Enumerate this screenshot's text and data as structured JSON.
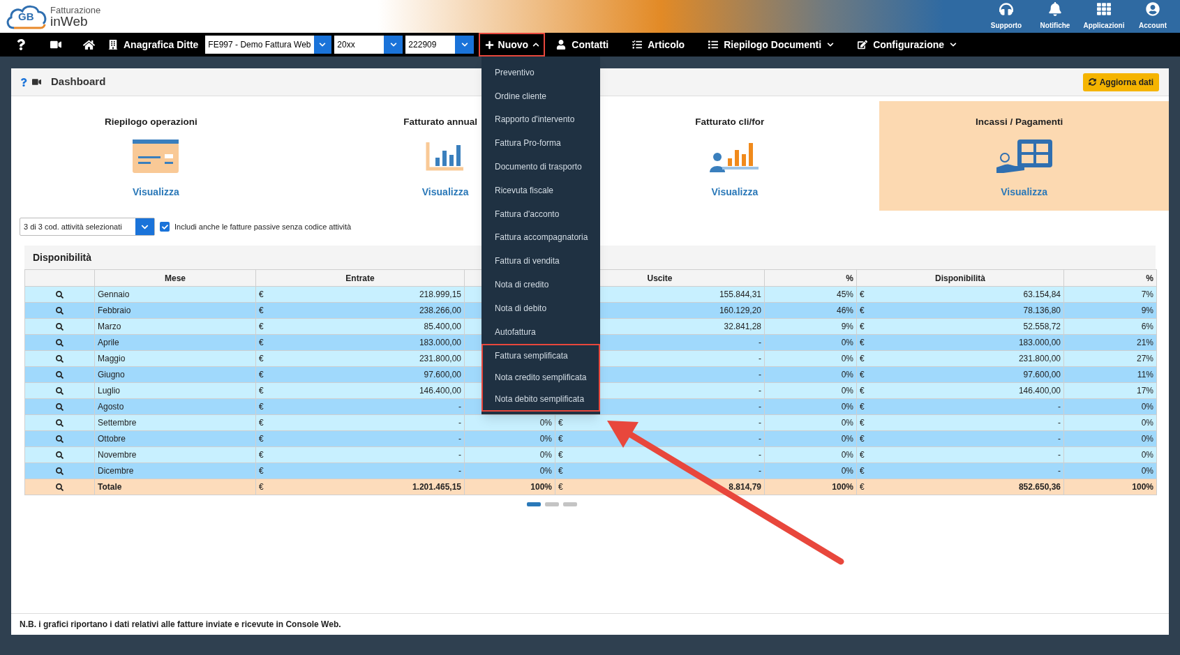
{
  "header": {
    "logo": {
      "mark": "GB",
      "line1": "Fatturazione",
      "line2": "inWeb"
    },
    "actions": [
      {
        "label": "Supporto"
      },
      {
        "label": "Notifiche"
      },
      {
        "label": "Applicazioni"
      },
      {
        "label": "Account"
      }
    ]
  },
  "nav": {
    "company_label": "Anagrafica Ditte",
    "selects": [
      {
        "value": "FE997 - Demo Fattura Web"
      },
      {
        "value": "20xx"
      },
      {
        "value": "222909"
      }
    ],
    "new_button": {
      "label": "Nuovo",
      "expanded": true,
      "outlined": true
    },
    "links": [
      {
        "label": "Contatti",
        "has_caret": false
      },
      {
        "label": "Articolo",
        "has_caret": false
      },
      {
        "label": "Riepilogo Documenti",
        "has_caret": true
      },
      {
        "label": "Configurazione",
        "has_caret": true
      }
    ]
  },
  "new_menu": {
    "items": [
      "Preventivo",
      "Ordine cliente",
      "Rapporto d'intervento",
      "Fattura Pro-forma",
      "Documento di trasporto",
      "Ricevuta fiscale",
      "Fattura d'acconto",
      "Fattura accompagnatoria",
      "Fattura di vendita",
      "Nota di credito",
      "Nota di debito",
      "Autofattura"
    ],
    "outlined_items": [
      "Fattura semplificata",
      "Nota credito semplificata",
      "Nota debito semplificata"
    ]
  },
  "dashboard": {
    "title": "Dashboard",
    "refresh_button": "Aggiorna dati",
    "tiles": [
      {
        "title": "Riepilogo operazioni",
        "link": "Visualizza",
        "selected": false
      },
      {
        "title": "Fatturato annual",
        "link": "Visualizza",
        "selected": false
      },
      {
        "title": "Fatturato cli/for",
        "link": "Visualizza",
        "selected": false
      },
      {
        "title": "Incassi / Pagamenti",
        "link": "Visualizza",
        "selected": true
      }
    ],
    "filter": {
      "value": "3 di 3 cod. attività selezionati",
      "checkbox": {
        "label": "Includi anche le fatture passive senza codice attività",
        "checked": true
      }
    },
    "availability": {
      "title": "Disponibilità",
      "columns": [
        {
          "label": "Mese"
        },
        {
          "label": "Entrate"
        },
        {},
        {
          "label": "Uscite"
        },
        {
          "label": "%"
        },
        {
          "label": "Disponibilità"
        },
        {
          "label": "%"
        }
      ],
      "rows": [
        {
          "kind": "month",
          "mese": "Gennaio",
          "entrate_cur": "€",
          "entrate": "218.999,15",
          "uscite": "155.844,31",
          "uscite_pct": "45%",
          "disp_cur": "€",
          "disp": "63.154,84",
          "disp_pct": "7%"
        },
        {
          "kind": "month",
          "mese": "Febbraio",
          "entrate_cur": "€",
          "entrate": "238.266,00",
          "uscite": "160.129,20",
          "uscite_pct": "46%",
          "disp_cur": "€",
          "disp": "78.136,80",
          "disp_pct": "9%"
        },
        {
          "kind": "month",
          "mese": "Marzo",
          "entrate_cur": "€",
          "entrate": "85.400,00",
          "uscite": "32.841,28",
          "uscite_pct": "9%",
          "disp_cur": "€",
          "disp": "52.558,72",
          "disp_pct": "6%"
        },
        {
          "kind": "month",
          "mese": "Aprile",
          "entrate_cur": "€",
          "entrate": "183.000,00",
          "uscite": "-",
          "uscite_pct": "0%",
          "disp_cur": "€",
          "disp": "183.000,00",
          "disp_pct": "21%"
        },
        {
          "kind": "month",
          "mese": "Maggio",
          "entrate_cur": "€",
          "entrate": "231.800,00",
          "uscite": "-",
          "uscite_pct": "0%",
          "disp_cur": "€",
          "disp": "231.800,00",
          "disp_pct": "27%"
        },
        {
          "kind": "month",
          "mese": "Giugno",
          "entrate_cur": "€",
          "entrate": "97.600,00",
          "uscite": "-",
          "uscite_pct": "0%",
          "disp_cur": "€",
          "disp": "97.600,00",
          "disp_pct": "11%"
        },
        {
          "kind": "month",
          "mese": "Luglio",
          "entrate_cur": "€",
          "entrate": "146.400,00",
          "uscite": "-",
          "uscite_pct": "0%",
          "disp_cur": "€",
          "disp": "146.400,00",
          "disp_pct": "17%"
        },
        {
          "kind": "month",
          "mese": "Agosto",
          "entrate_cur": "€",
          "entrate": "-",
          "uscite": "-",
          "uscite_pct": "0%",
          "disp_cur": "€",
          "disp": "-",
          "disp_pct": "0%"
        },
        {
          "kind": "month",
          "mese": "Settembre",
          "entrate_cur": "€",
          "entrate": "-",
          "entrate_pct": "0%",
          "uscite_cur": "€",
          "uscite": "-",
          "uscite_pct": "0%",
          "disp_cur": "€",
          "disp": "-",
          "disp_pct": "0%"
        },
        {
          "kind": "month",
          "mese": "Ottobre",
          "entrate_cur": "€",
          "entrate": "-",
          "entrate_pct": "0%",
          "uscite_cur": "€",
          "uscite": "-",
          "uscite_pct": "0%",
          "disp_cur": "€",
          "disp": "-",
          "disp_pct": "0%"
        },
        {
          "kind": "month",
          "mese": "Novembre",
          "entrate_cur": "€",
          "entrate": "-",
          "entrate_pct": "0%",
          "uscite_cur": "€",
          "uscite": "-",
          "uscite_pct": "0%",
          "disp_cur": "€",
          "disp": "-",
          "disp_pct": "0%"
        },
        {
          "kind": "month",
          "mese": "Dicembre",
          "entrate_cur": "€",
          "entrate": "-",
          "entrate_pct": "0%",
          "uscite_cur": "€",
          "uscite": "-",
          "uscite_pct": "0%",
          "disp_cur": "€",
          "disp": "-",
          "disp_pct": "0%"
        },
        {
          "kind": "total",
          "mese": "Totale",
          "entrate_cur": "€",
          "entrate": "1.201.465,15",
          "entrate_pct": "100%",
          "uscite_cur": "€",
          "uscite": "8.814,79",
          "uscite_pct": "100%",
          "disp_cur": "€",
          "disp": "852.650,36",
          "disp_pct": "100%"
        }
      ]
    },
    "pager": [
      {
        "selected": true
      },
      {
        "selected": false
      },
      {
        "selected": false
      }
    ],
    "note": "N.B. i grafici riportano i dati relativi alle fatture inviate e ricevute in Console Web."
  }
}
